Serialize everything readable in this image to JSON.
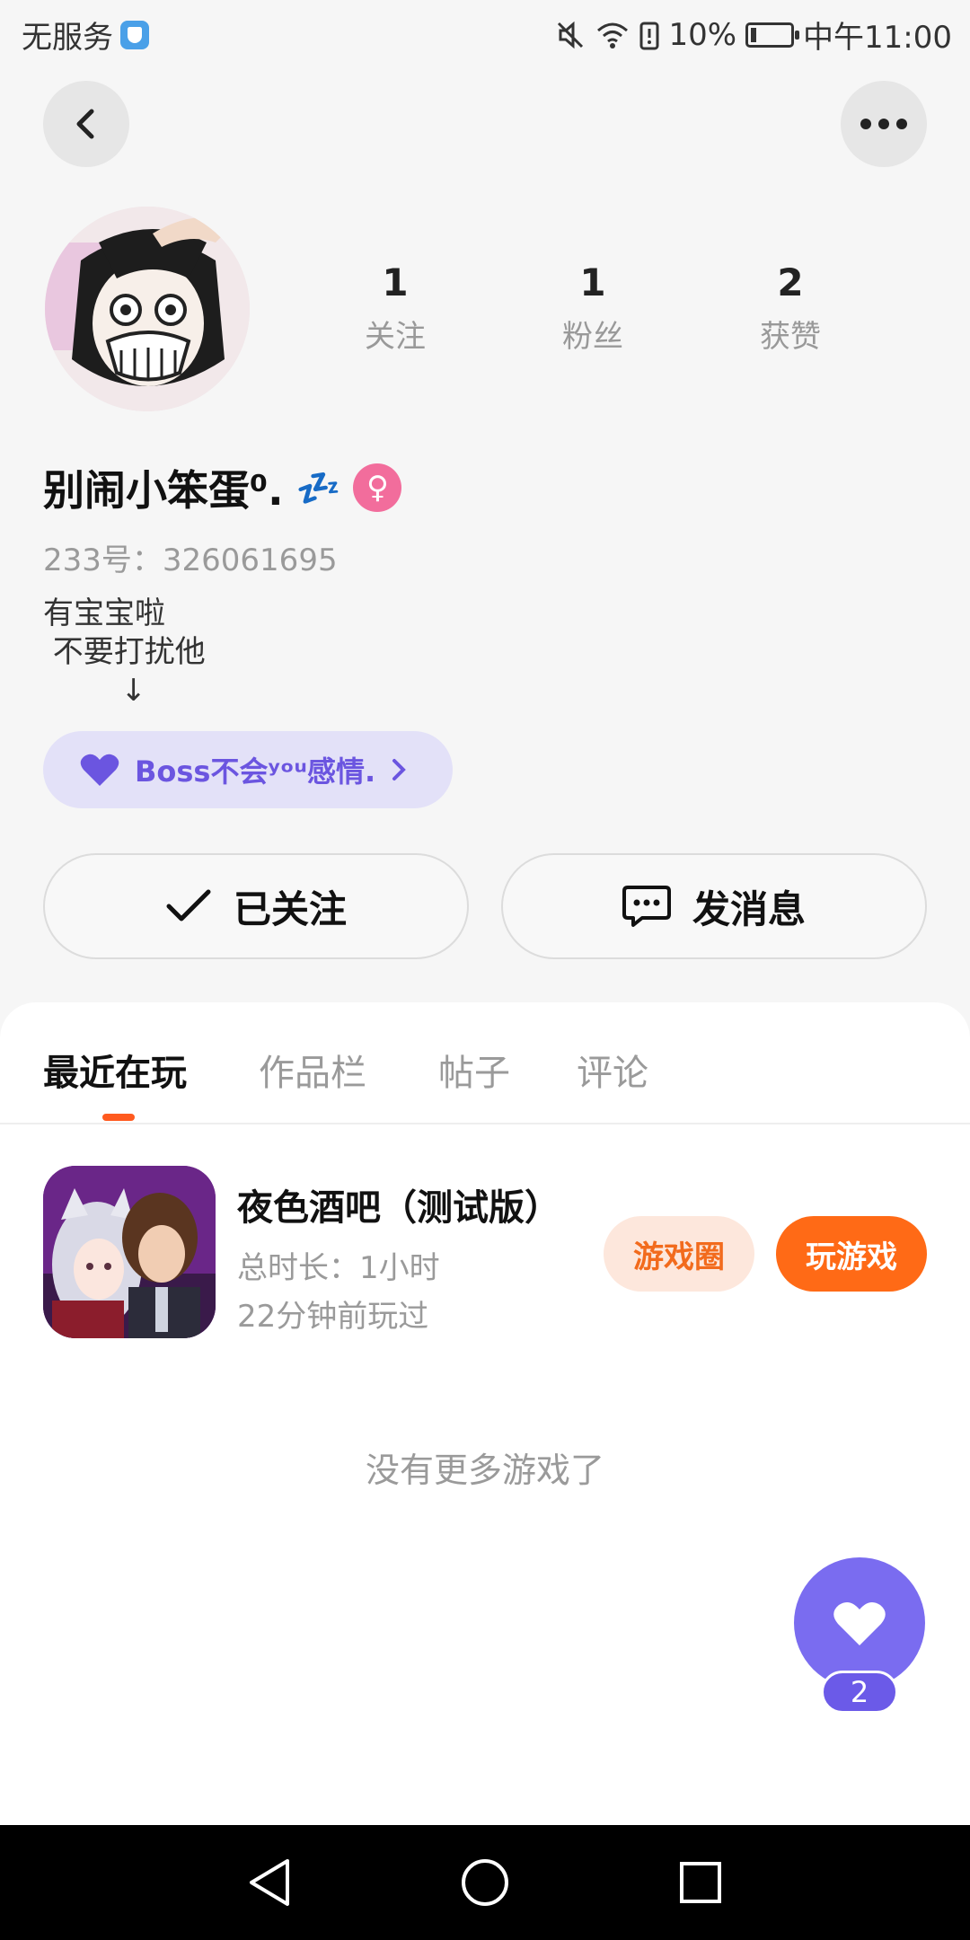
{
  "status_bar": {
    "carrier": "无服务",
    "battery_percent": "10%",
    "time": "中午11:00"
  },
  "profile": {
    "stats": [
      {
        "value": "1",
        "label": "关注"
      },
      {
        "value": "1",
        "label": "粉丝"
      },
      {
        "value": "2",
        "label": "获赞"
      }
    ],
    "username": "别闹小笨蛋⁰.",
    "username_suffix": "💤",
    "uid": "233号：326061695",
    "bio": "有宝宝啦\n 不要打扰他\n        ↓",
    "tag_text": "Boss不会ʸᵒᵘ感情."
  },
  "actions": {
    "follow_label": "已关注",
    "message_label": "发消息"
  },
  "tabs": [
    "最近在玩",
    "作品栏",
    "帖子",
    "评论"
  ],
  "game": {
    "title": "夜色酒吧（测试版）",
    "duration": "总时长：1小时",
    "last_played": "22分钟前玩过",
    "circle_button": "游戏圈",
    "play_button": "玩游戏"
  },
  "no_more_text": "没有更多游戏了",
  "fab": {
    "count": "2"
  },
  "colors": {
    "accent_orange": "#ff6a16",
    "accent_purple": "#7a6cf0",
    "tag_bg": "#e3e1f8"
  },
  "icons": [
    "back-icon",
    "more-icon",
    "mute-icon",
    "wifi-icon",
    "battery-icon",
    "check-icon",
    "chat-icon",
    "heart-icon",
    "nav-back-icon",
    "nav-home-icon",
    "nav-recents-icon"
  ]
}
